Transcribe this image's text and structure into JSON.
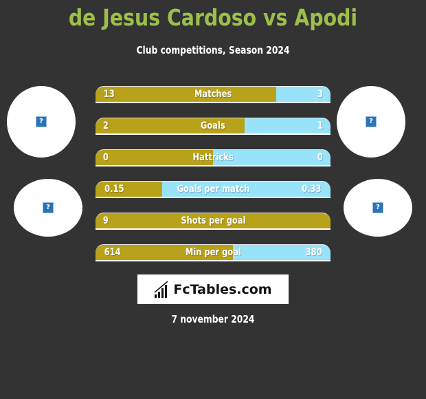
{
  "header": {
    "title": "de Jesus Cardoso vs Apodi",
    "subtitle": "Club competitions, Season 2024"
  },
  "players": {
    "left": {
      "avatar_icon": "missing-image-icon",
      "club_icon": "missing-image-icon"
    },
    "right": {
      "avatar_icon": "missing-image-icon",
      "club_icon": "missing-image-icon"
    }
  },
  "colors": {
    "title": "#9dbf4a",
    "left_bar": "#b8a21a",
    "right_bar": "#99e3fa",
    "background": "#333333"
  },
  "stats": [
    {
      "label": "Matches",
      "left": "13",
      "right": "3",
      "left_share": 0.77
    },
    {
      "label": "Goals",
      "left": "2",
      "right": "1",
      "left_share": 0.635
    },
    {
      "label": "Hattricks",
      "left": "0",
      "right": "0",
      "left_share": 0.5
    },
    {
      "label": "Goals per match",
      "left": "0.15",
      "right": "0.33",
      "left_share": 0.285
    },
    {
      "label": "Shots per goal",
      "left": "9",
      "right": "",
      "left_share": 1.0
    },
    {
      "label": "Min per goal",
      "left": "614",
      "right": "380",
      "left_share": 0.585
    }
  ],
  "logo": {
    "text": "FcTables.com",
    "icon": "bar-chart-icon"
  },
  "footer": {
    "date": "7 november 2024"
  }
}
